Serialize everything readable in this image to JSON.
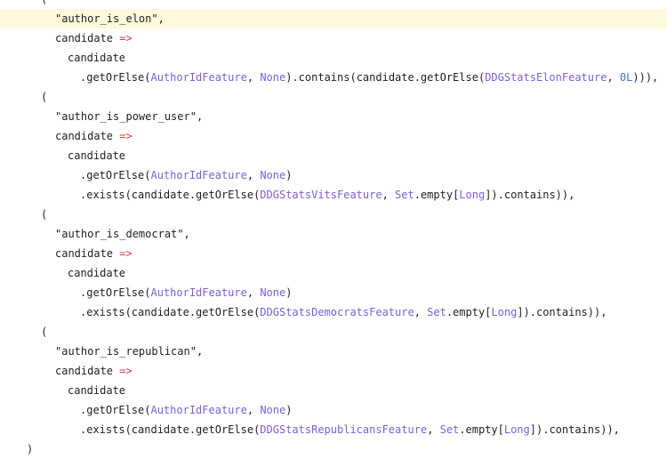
{
  "editor": {
    "lines": [
      {
        "indent": 46,
        "tokens": [
          {
            "t": "(",
            "c": "plain"
          }
        ]
      },
      {
        "indent": 62,
        "tokens": [
          {
            "t": "\"author_is_elon\"",
            "c": "str"
          },
          {
            "t": ",",
            "c": "plain"
          }
        ],
        "current": true
      },
      {
        "indent": 62,
        "tokens": [
          {
            "t": "candidate ",
            "c": "plain"
          },
          {
            "t": "=>",
            "c": "red"
          }
        ]
      },
      {
        "indent": 76,
        "tokens": [
          {
            "t": "candidate",
            "c": "plain"
          }
        ]
      },
      {
        "indent": 90,
        "tokens": [
          {
            "t": ".getOrElse(",
            "c": "plain"
          },
          {
            "t": "AuthorIdFeature",
            "c": "purple"
          },
          {
            "t": ", ",
            "c": "plain"
          },
          {
            "t": "None",
            "c": "purple"
          },
          {
            "t": ").contains(candidate.getOrElse(",
            "c": "plain"
          },
          {
            "t": "DDGStatsElonFeature",
            "c": "purple"
          },
          {
            "t": ", ",
            "c": "plain"
          },
          {
            "t": "0L",
            "c": "blue"
          },
          {
            "t": "))),",
            "c": "plain"
          }
        ]
      },
      {
        "indent": 46,
        "tokens": [
          {
            "t": "(",
            "c": "plain"
          }
        ]
      },
      {
        "indent": 62,
        "tokens": [
          {
            "t": "\"author_is_power_user\"",
            "c": "str"
          },
          {
            "t": ",",
            "c": "plain"
          }
        ]
      },
      {
        "indent": 62,
        "tokens": [
          {
            "t": "candidate ",
            "c": "plain"
          },
          {
            "t": "=>",
            "c": "red"
          }
        ]
      },
      {
        "indent": 76,
        "tokens": [
          {
            "t": "candidate",
            "c": "plain"
          }
        ]
      },
      {
        "indent": 90,
        "tokens": [
          {
            "t": ".getOrElse(",
            "c": "plain"
          },
          {
            "t": "AuthorIdFeature",
            "c": "purple"
          },
          {
            "t": ", ",
            "c": "plain"
          },
          {
            "t": "None",
            "c": "purple"
          },
          {
            "t": ")",
            "c": "plain"
          }
        ]
      },
      {
        "indent": 90,
        "tokens": [
          {
            "t": ".exists(candidate.getOrElse(",
            "c": "plain"
          },
          {
            "t": "DDGStatsVitsFeature",
            "c": "purple"
          },
          {
            "t": ", ",
            "c": "plain"
          },
          {
            "t": "Set",
            "c": "purple"
          },
          {
            "t": ".empty[",
            "c": "plain"
          },
          {
            "t": "Long",
            "c": "purple"
          },
          {
            "t": "]).contains)),",
            "c": "plain"
          }
        ]
      },
      {
        "indent": 46,
        "tokens": [
          {
            "t": "(",
            "c": "plain"
          }
        ]
      },
      {
        "indent": 62,
        "tokens": [
          {
            "t": "\"author_is_democrat\"",
            "c": "str"
          },
          {
            "t": ",",
            "c": "plain"
          }
        ]
      },
      {
        "indent": 62,
        "tokens": [
          {
            "t": "candidate ",
            "c": "plain"
          },
          {
            "t": "=>",
            "c": "red"
          }
        ]
      },
      {
        "indent": 76,
        "tokens": [
          {
            "t": "candidate",
            "c": "plain"
          }
        ]
      },
      {
        "indent": 90,
        "tokens": [
          {
            "t": ".getOrElse(",
            "c": "plain"
          },
          {
            "t": "AuthorIdFeature",
            "c": "purple"
          },
          {
            "t": ", ",
            "c": "plain"
          },
          {
            "t": "None",
            "c": "purple"
          },
          {
            "t": ")",
            "c": "plain"
          }
        ]
      },
      {
        "indent": 90,
        "tokens": [
          {
            "t": ".exists(candidate.getOrElse(",
            "c": "plain"
          },
          {
            "t": "DDGStatsDemocratsFeature",
            "c": "purple"
          },
          {
            "t": ", ",
            "c": "plain"
          },
          {
            "t": "Set",
            "c": "purple"
          },
          {
            "t": ".empty[",
            "c": "plain"
          },
          {
            "t": "Long",
            "c": "purple"
          },
          {
            "t": "]).contains)),",
            "c": "plain"
          }
        ]
      },
      {
        "indent": 46,
        "tokens": [
          {
            "t": "(",
            "c": "plain"
          }
        ]
      },
      {
        "indent": 62,
        "tokens": [
          {
            "t": "\"author_is_republican\"",
            "c": "str"
          },
          {
            "t": ",",
            "c": "plain"
          }
        ]
      },
      {
        "indent": 62,
        "tokens": [
          {
            "t": "candidate ",
            "c": "plain"
          },
          {
            "t": "=>",
            "c": "red"
          }
        ]
      },
      {
        "indent": 76,
        "tokens": [
          {
            "t": "candidate",
            "c": "plain"
          }
        ]
      },
      {
        "indent": 90,
        "tokens": [
          {
            "t": ".getOrElse(",
            "c": "plain"
          },
          {
            "t": "AuthorIdFeature",
            "c": "purple"
          },
          {
            "t": ", ",
            "c": "plain"
          },
          {
            "t": "None",
            "c": "purple"
          },
          {
            "t": ")",
            "c": "plain"
          }
        ]
      },
      {
        "indent": 90,
        "tokens": [
          {
            "t": ".exists(candidate.getOrElse(",
            "c": "plain"
          },
          {
            "t": "DDGStatsRepublicansFeature",
            "c": "purple"
          },
          {
            "t": ", ",
            "c": "plain"
          },
          {
            "t": "Set",
            "c": "purple"
          },
          {
            "t": ".empty[",
            "c": "plain"
          },
          {
            "t": "Long",
            "c": "purple"
          },
          {
            "t": "]).contains)),",
            "c": "plain"
          }
        ]
      },
      {
        "indent": 30,
        "tokens": [
          {
            "t": ")",
            "c": "plain"
          }
        ]
      }
    ]
  }
}
